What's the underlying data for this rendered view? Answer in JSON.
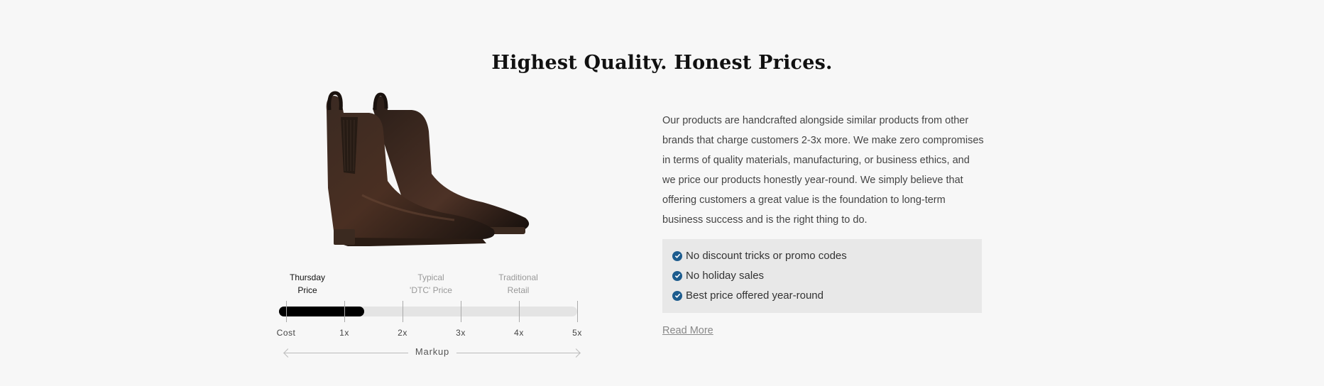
{
  "title": "Highest Quality. Honest Prices.",
  "product_image": {
    "alt": "chelsea-boot-icon"
  },
  "scale": {
    "labels": [
      {
        "line1": "Thursday",
        "line2": "Price",
        "active": true
      },
      {
        "line1": "Typical",
        "line2": "'DTC' Price",
        "active": false
      },
      {
        "line1": "Traditional",
        "line2": "Retail",
        "active": false
      }
    ],
    "ticks": [
      "Cost",
      "1x",
      "2x",
      "3x",
      "4x",
      "5x"
    ],
    "fill_fraction": 0.285,
    "axis_label": "Markup"
  },
  "description": "Our products are handcrafted alongside similar products from other brands that charge customers 2-3x more. We make zero compromises in terms of quality materials, manufacturing, or business ethics, and we price our products honestly year-round. We simply believe that offering customers a great value is the foundation to long-term business success and is the right thing to do.",
  "features": [
    "No discount tricks or promo codes",
    "No holiday sales",
    "Best price offered year-round"
  ],
  "read_more": "Read More",
  "colors": {
    "check": "#1d5c8e",
    "fill": "#000000",
    "track": "#e4e4e4",
    "panel": "#e8e8e8"
  }
}
